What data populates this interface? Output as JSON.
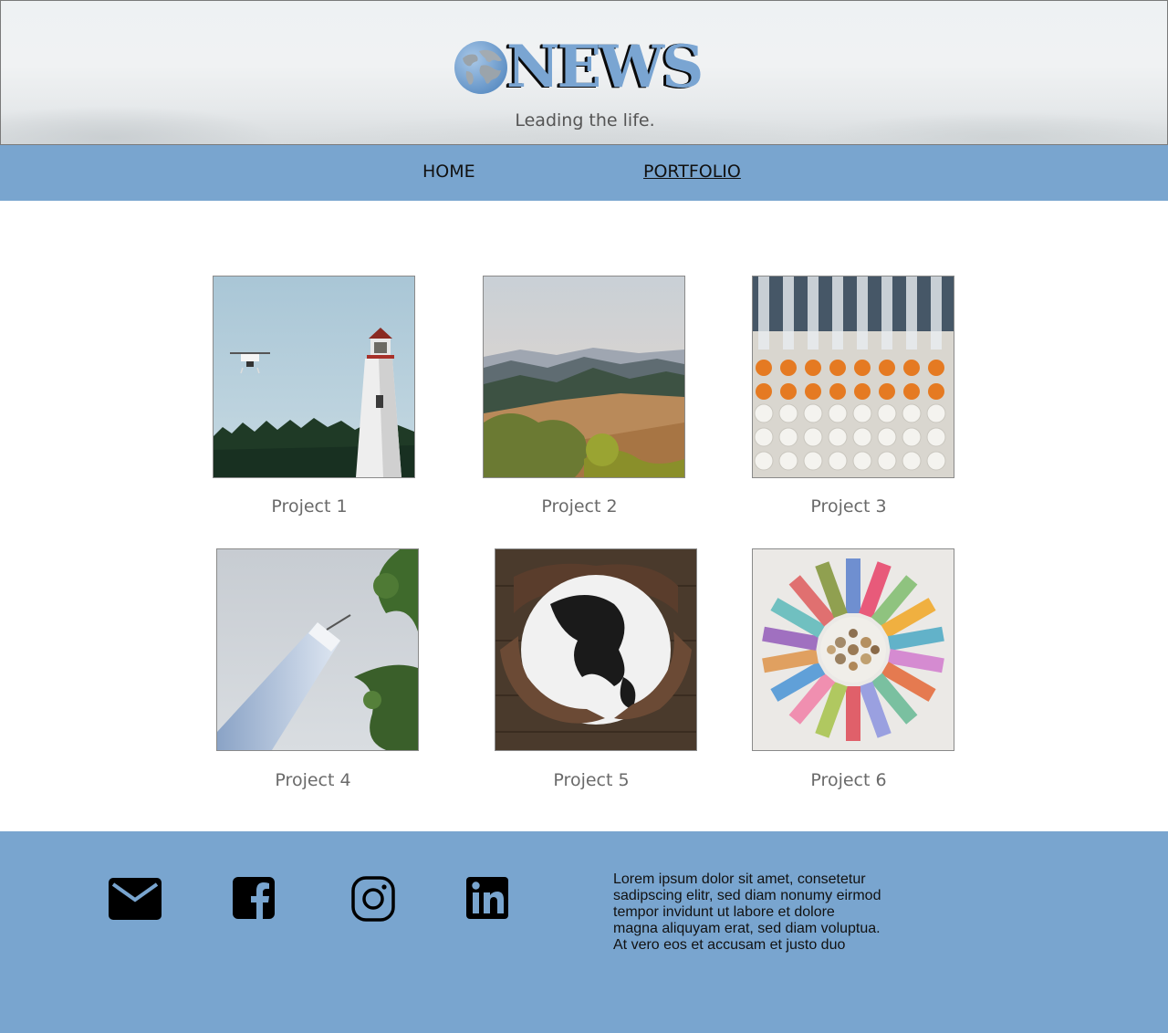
{
  "brand": {
    "logo_text": "NEWS",
    "tagline": "Leading the life.",
    "accent_color": "#79a5cf"
  },
  "nav": {
    "items": [
      {
        "label": "HOME",
        "active": false
      },
      {
        "label": "PORTFOLIO",
        "active": true
      }
    ]
  },
  "gallery": {
    "projects": [
      {
        "label": "Project 1",
        "image": "lighthouse-with-drone"
      },
      {
        "label": "Project 2",
        "image": "mountain-valley-landscape"
      },
      {
        "label": "Project 3",
        "image": "lab-pipettes-well-plate"
      },
      {
        "label": "Project 4",
        "image": "skyscraper-with-leaves"
      },
      {
        "label": "Project 5",
        "image": "hands-holding-globe"
      },
      {
        "label": "Project 6",
        "image": "world-banknotes-and-coins"
      }
    ]
  },
  "footer": {
    "icons": [
      "mail-icon",
      "facebook-icon",
      "instagram-icon",
      "linkedin-icon"
    ],
    "text_lines": [
      "Lorem ipsum dolor sit amet, consetetur",
      "sadipscing elitr, sed diam nonumy eirmod",
      "tempor invidunt ut labore et dolore",
      "magna aliquyam erat, sed diam voluptua.",
      "At vero eos et accusam et justo duo"
    ]
  }
}
